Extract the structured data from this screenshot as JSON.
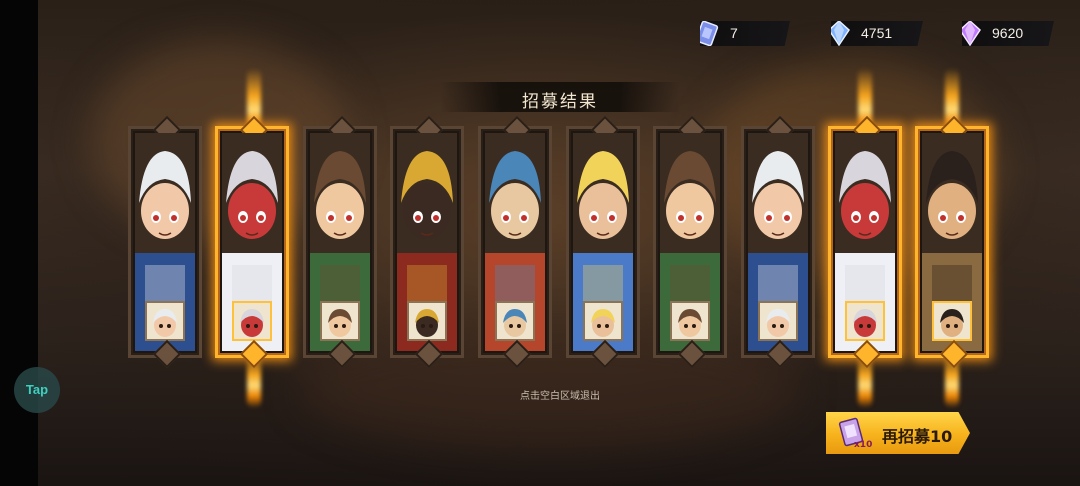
{
  "currencies": [
    {
      "icon": "ticket-icon",
      "value": "7"
    },
    {
      "icon": "blue-crystal-icon",
      "value": "4751"
    },
    {
      "icon": "purple-crystal-icon",
      "value": "9620"
    }
  ],
  "title": "招募结果",
  "exit_hint": "点击空白区域退出",
  "tap_label": "Tap",
  "recruit_button": {
    "label": "再招募10",
    "ticket_count": "x10"
  },
  "cards": [
    {
      "character": "egg-hat-boy",
      "rarity": "normal",
      "palette": [
        "#e9ecef",
        "#2e4f8f",
        "#f2c9a8"
      ]
    },
    {
      "character": "silver-hair-mage",
      "rarity": "legendary",
      "palette": [
        "#d8d6dc",
        "#eef0f5",
        "#c83a3a"
      ]
    },
    {
      "character": "cowboy-gunner",
      "rarity": "normal",
      "palette": [
        "#6a4a32",
        "#3d6a3a",
        "#f0c8a0"
      ]
    },
    {
      "character": "golden-mask-warrior",
      "rarity": "normal",
      "palette": [
        "#d9a832",
        "#8c2a20",
        "#3a2a22"
      ]
    },
    {
      "character": "bearded-pirate",
      "rarity": "normal",
      "palette": [
        "#4a86b8",
        "#b5462b",
        "#e8c8a0"
      ]
    },
    {
      "character": "blonde-fighter",
      "rarity": "normal",
      "palette": [
        "#f2d35a",
        "#4a7ac8",
        "#e9c09a"
      ]
    },
    {
      "character": "cowboy-gunner",
      "rarity": "normal",
      "palette": [
        "#6a4a32",
        "#3d6a3a",
        "#f0c8a0"
      ]
    },
    {
      "character": "egg-hat-boy",
      "rarity": "normal",
      "palette": [
        "#e9ecef",
        "#2e4f8f",
        "#f2c9a8"
      ]
    },
    {
      "character": "silver-hair-mage",
      "rarity": "legendary",
      "palette": [
        "#d8d6dc",
        "#eef0f5",
        "#c83a3a"
      ]
    },
    {
      "character": "top-hat-gambler",
      "rarity": "legendary",
      "palette": [
        "#2a201c",
        "#8a6a40",
        "#e0b080"
      ]
    }
  ]
}
